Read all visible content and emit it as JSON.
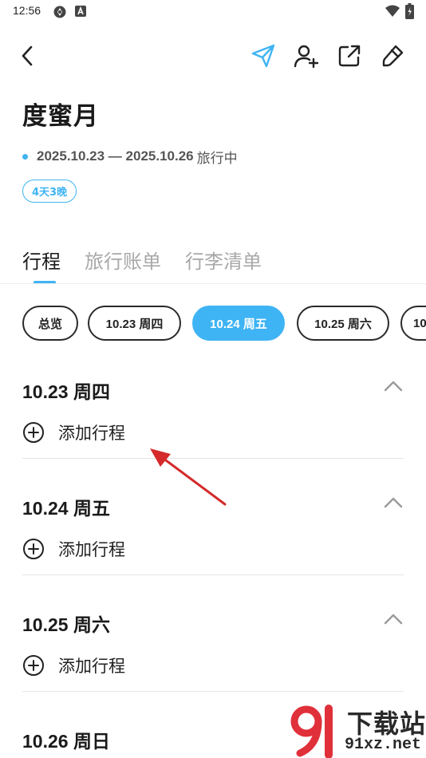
{
  "status_bar": {
    "time": "12:56",
    "left_icons": [
      "sync-icon",
      "a-notification-icon"
    ],
    "right_icons": [
      "wifi-icon",
      "battery-icon"
    ]
  },
  "toolbar": {
    "back_icon": "chevron-left-icon",
    "actions": [
      "send-icon",
      "add-person-icon",
      "share-icon",
      "edit-icon"
    ]
  },
  "trip": {
    "title": "度蜜月",
    "dates": "2025.10.23 — 2025.10.26",
    "status": "旅行中",
    "duration": "4天3晚"
  },
  "tabs": [
    {
      "label": "行程",
      "active": true
    },
    {
      "label": "旅行账单",
      "active": false
    },
    {
      "label": "行李清单",
      "active": false
    }
  ],
  "chips": [
    {
      "label": "总览",
      "selected": false
    },
    {
      "label": "10.23 周四",
      "selected": false
    },
    {
      "label": "10.24 周五",
      "selected": true
    },
    {
      "label": "10.25 周六",
      "selected": false
    },
    {
      "label": "10",
      "selected": false
    }
  ],
  "days": [
    {
      "title": "10.23 周四",
      "add_label": "添加行程"
    },
    {
      "title": "10.24 周五",
      "add_label": "添加行程"
    },
    {
      "title": "10.25 周六",
      "add_label": "添加行程"
    },
    {
      "title": "10.26 周日"
    }
  ],
  "watermark": {
    "top": "下载站",
    "bottom": "91xz.net"
  },
  "colors": {
    "accent": "#3fb4f4",
    "annotation_arrow": "#d42a2a",
    "watermark_red": "#e0303a"
  }
}
